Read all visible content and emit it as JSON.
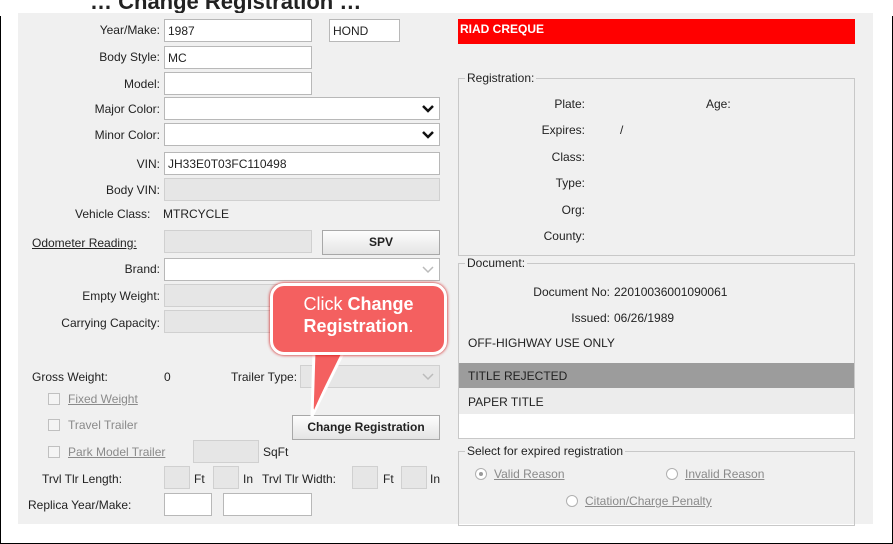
{
  "page_title": "… Change Registration …",
  "banner": {
    "name": "RIAD CREQUE",
    "color": "#ff0000"
  },
  "vehicle": {
    "year_make_label": "Year/Make:",
    "year": "1987",
    "make": "HOND",
    "body_style_label": "Body Style:",
    "body_style": "MC",
    "model_label": "Model:",
    "model": "",
    "major_color_label": "Major Color:",
    "major_color": "",
    "minor_color_label": "Minor Color:",
    "minor_color": "",
    "vin_label": "VIN:",
    "vin": "JH33E0T03FC110498",
    "body_vin_label": "Body VIN:",
    "body_vin": "",
    "vehicle_class_label": "Vehicle Class:",
    "vehicle_class": "MTRCYCLE",
    "odometer_label": "Odometer Reading:",
    "odometer": "",
    "spv_button": "SPV",
    "brand_label": "Brand:",
    "brand": "",
    "empty_weight_label": "Empty Weight:",
    "empty_weight": "",
    "carrying_capacity_label": "Carrying Capacity:",
    "carrying_capacity": "",
    "gross_weight_label": "Gross Weight:",
    "gross_weight": "0",
    "trailer_type_label": "Trailer Type:",
    "trailer_type": "",
    "fixed_weight_label": "Fixed Weight",
    "travel_trailer_label": "Travel Trailer",
    "park_model_trailer_label": "Park Model Trailer",
    "sqft_unit": "SqFt",
    "change_registration_button": "Change Registration",
    "trvl_tlr_length_label": "Trvl Tlr Length:",
    "ft_unit": "Ft",
    "in_unit": "In",
    "trvl_tlr_width_label": "Trvl Tlr Width:",
    "replica_year_make_label": "Replica Year/Make:"
  },
  "registration": {
    "title": "Registration:",
    "plate_label": "Plate:",
    "age_label": "Age:",
    "expires_label": "Expires:",
    "expires_value": "/",
    "class_label": "Class:",
    "type_label": "Type:",
    "org_label": "Org:",
    "county_label": "County:"
  },
  "document": {
    "title": "Document:",
    "doc_no_label": "Document No:",
    "doc_no": "22010036001090061",
    "issued_label": "Issued:",
    "issued": "06/26/1989",
    "notes": [
      "OFF-HIGHWAY USE ONLY",
      "TITLE REJECTED",
      "PAPER TITLE"
    ]
  },
  "expired": {
    "title": "Select for expired registration",
    "valid_reason": "Valid Reason",
    "invalid_reason": "Invalid Reason",
    "citation_penalty": "Citation/Charge Penalty"
  },
  "callout": {
    "line1_prefix": "Click ",
    "line1_bold": "Change",
    "line2_bold": "Registration",
    "line2_suffix": "."
  }
}
